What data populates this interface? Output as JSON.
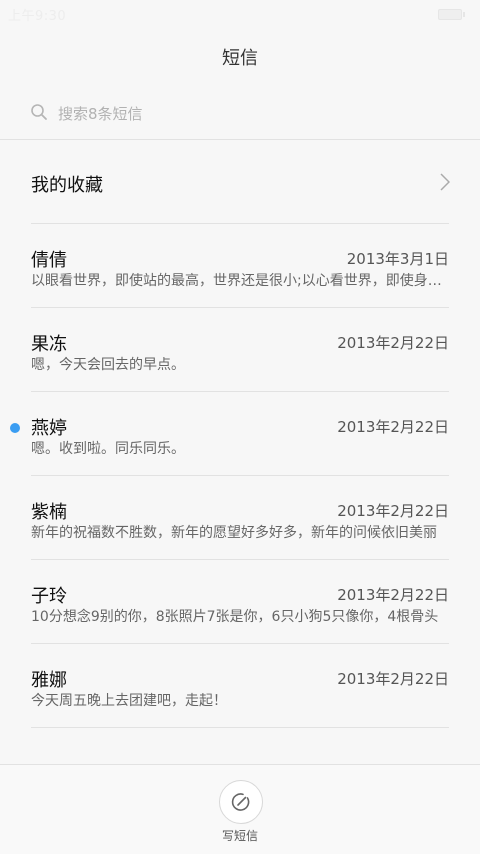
{
  "status_bar": {
    "time": "上午9:30"
  },
  "header": {
    "title": "短信"
  },
  "search": {
    "placeholder": "搜索8条短信"
  },
  "favorites": {
    "label": "我的收藏"
  },
  "threads": [
    {
      "name": "倩倩",
      "date": "2013年3月1日",
      "preview": "以眼看世界，即使站的最高，世界还是很小;以心看世界，即使身处最低处，世界也很大",
      "unread": false
    },
    {
      "name": "果冻",
      "date": "2013年2月22日",
      "preview": "嗯，今天会回去的早点。",
      "unread": false
    },
    {
      "name": "燕婷",
      "date": "2013年2月22日",
      "preview": "嗯。收到啦。同乐同乐。",
      "unread": true
    },
    {
      "name": "紫楠",
      "date": "2013年2月22日",
      "preview": "新年的祝福数不胜数，新年的愿望好多好多，新年的问候依旧美丽",
      "unread": false
    },
    {
      "name": "子玲",
      "date": "2013年2月22日",
      "preview": "10分想念9别的你，8张照片7张是你，6只小狗5只像你，4根骨头",
      "unread": false
    },
    {
      "name": "雅娜",
      "date": "2013年2月22日",
      "preview": "今天周五晚上去团建吧，走起！",
      "unread": false
    }
  ],
  "bottom": {
    "compose_label": "写短信"
  },
  "colors": {
    "unread_dot": "#3a9df2",
    "background": "#f7f7f7",
    "divider": "#e2e2e2"
  }
}
